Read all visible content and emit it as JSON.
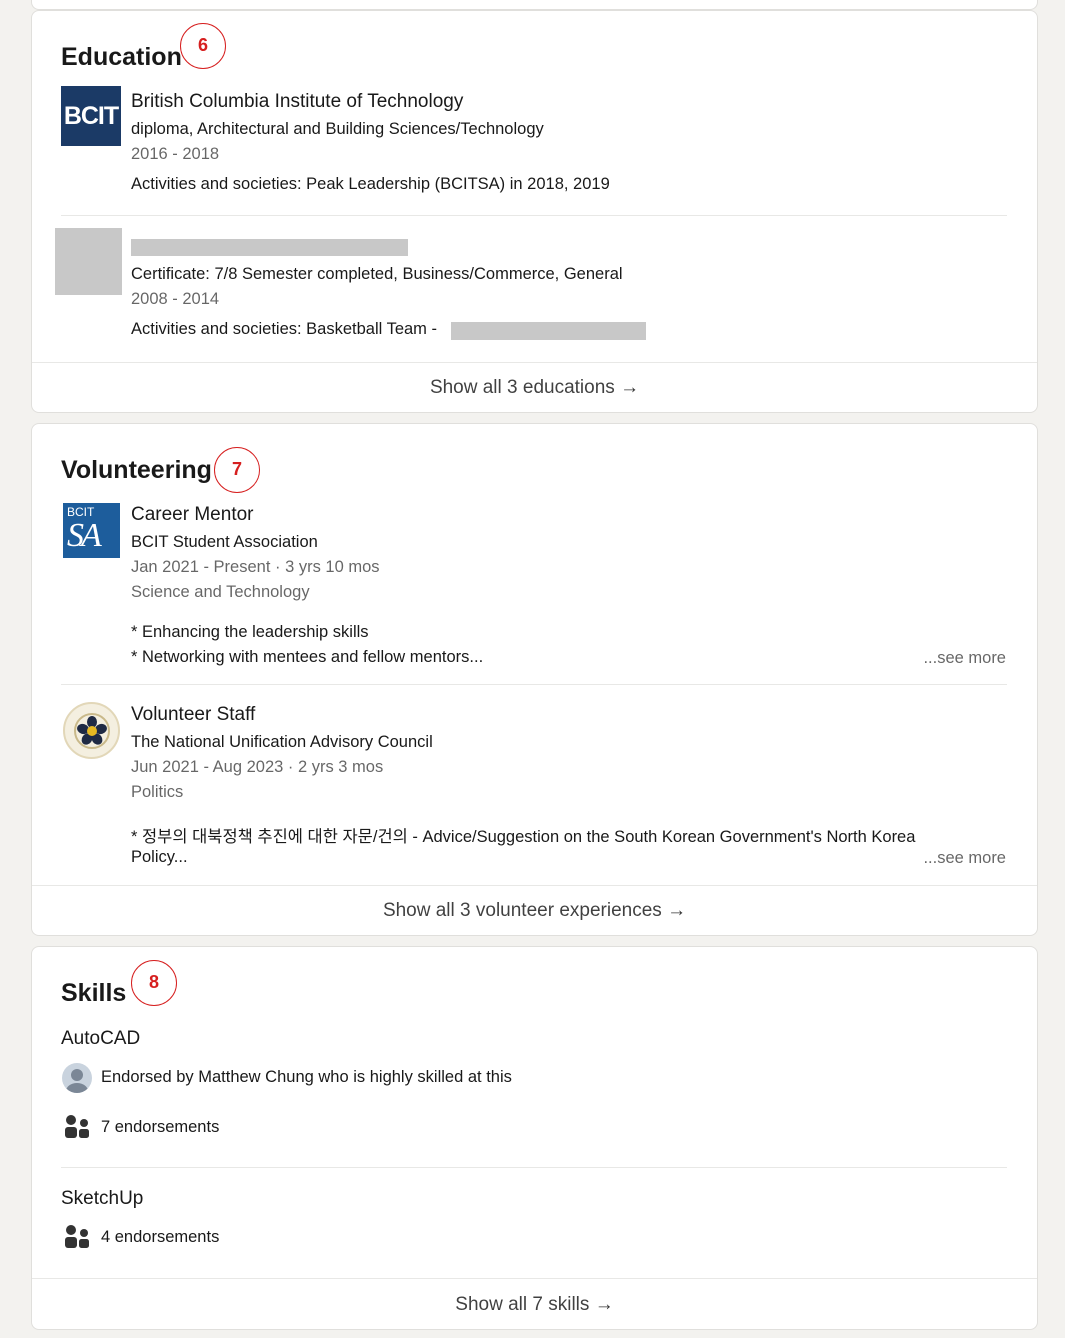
{
  "education": {
    "title": "Education",
    "badge": "6",
    "items": [
      {
        "logo_text": "BCIT",
        "school": "British Columbia Institute of Technology",
        "degree": "diploma, Architectural and Building Sciences/Technology",
        "dates": "2016 - 2018",
        "activities": "Activities and societies: Peak Leadership (BCITSA) in 2018, 2019"
      },
      {
        "degree": "Certificate: 7/8 Semester completed, Business/Commerce, General",
        "dates": "2008 - 2014",
        "activities": "Activities and societies: Basketball Team -"
      }
    ],
    "show_all": "Show all 3 educations"
  },
  "volunteering": {
    "title": "Volunteering",
    "badge": "7",
    "items": [
      {
        "logo_small": "BCIT",
        "logo_big": "SA",
        "role": "Career Mentor",
        "org": "BCIT Student Association",
        "dates": "Jan 2021 - Present · 3 yrs 10 mos",
        "cause": "Science and Technology",
        "line1": "* Enhancing the leadership skills",
        "line2": "* Networking with mentees and fellow mentors...",
        "see_more": "...see more"
      },
      {
        "role": "Volunteer Staff",
        "org": "The National Unification Advisory Council",
        "dates": "Jun 2021 - Aug 2023 · 2 yrs 3 mos",
        "cause": "Politics",
        "line1": "* 정부의 대북정책 추진에 대한 자문/건의 - Advice/Suggestion on the South Korean Government's North Korea",
        "line2": "Policy...",
        "see_more": "...see more"
      }
    ],
    "show_all": "Show all 3 volunteer experiences"
  },
  "skills": {
    "title": "Skills",
    "badge": "8",
    "items": [
      {
        "name": "AutoCAD",
        "endorsed_by": "Endorsed by Matthew Chung who is highly skilled at this",
        "endorsements": "7 endorsements"
      },
      {
        "name": "SketchUp",
        "endorsements": "4 endorsements"
      }
    ],
    "show_all": "Show all 7 skills"
  },
  "arrow": "→",
  "icons": [
    "arrow-right-icon",
    "people-icon",
    "avatar",
    "bcit-logo",
    "bcitsa-logo",
    "nuac-logo"
  ]
}
